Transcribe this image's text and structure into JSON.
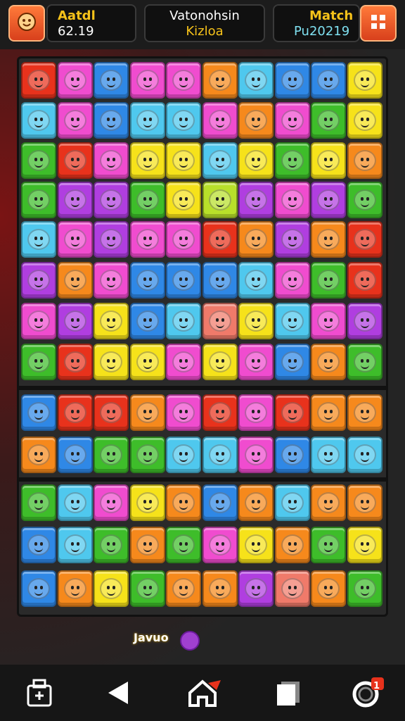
{
  "hud": {
    "left_title": "Aatdl",
    "left_value": "62.19",
    "mid_title": "Vatonohsin",
    "mid_subtitle": "Kizloa",
    "right_title": "Match",
    "right_value": "Pu20219"
  },
  "colors": {
    "red": "#e8321c",
    "pink": "#f04ccf",
    "blue": "#2f88e6",
    "yellow": "#f6e21a",
    "orange": "#f6891c",
    "cyan": "#4fc8ee",
    "green": "#3ebd2a",
    "purple": "#b03ee0",
    "magenta": "#e8468a",
    "lime": "#b8e02a",
    "salmon": "#f07a6a"
  },
  "board": {
    "rows": [
      [
        "red",
        "pink",
        "blue",
        "pink",
        "pink",
        "orange",
        "cyan",
        "blue",
        "blue",
        "yellow"
      ],
      [
        "cyan",
        "pink",
        "blue",
        "cyan",
        "cyan",
        "pink",
        "orange",
        "pink",
        "green",
        "yellow"
      ],
      [
        "green",
        "red",
        "pink",
        "yellow",
        "yellow",
        "cyan",
        "yellow",
        "green",
        "yellow",
        "orange"
      ],
      [
        "green",
        "purple",
        "purple",
        "green",
        "yellow",
        "lime",
        "purple",
        "pink",
        "purple",
        "green"
      ],
      [
        "cyan",
        "pink",
        "purple",
        "pink",
        "pink",
        "red",
        "orange",
        "purple",
        "orange",
        "red"
      ],
      [
        "purple",
        "orange",
        "pink",
        "blue",
        "blue",
        "blue",
        "cyan",
        "pink",
        "green",
        "red"
      ],
      [
        "pink",
        "purple",
        "yellow",
        "blue",
        "cyan",
        "salmon",
        "yellow",
        "cyan",
        "pink",
        "purple"
      ],
      [
        "green",
        "red",
        "yellow",
        "yellow",
        "pink",
        "yellow",
        "pink",
        "blue",
        "orange",
        "green"
      ],
      [
        "blue",
        "red",
        "red",
        "orange",
        "pink",
        "red",
        "pink",
        "red",
        "orange",
        "orange"
      ],
      [
        "orange",
        "blue",
        "green",
        "green",
        "cyan",
        "cyan",
        "pink",
        "blue",
        "cyan",
        "cyan"
      ],
      [
        "green",
        "cyan",
        "pink",
        "yellow",
        "orange",
        "blue",
        "orange",
        "cyan",
        "orange",
        "orange"
      ],
      [
        "blue",
        "cyan",
        "green",
        "orange",
        "green",
        "pink",
        "yellow",
        "orange",
        "green",
        "yellow"
      ],
      [
        "blue",
        "orange",
        "yellow",
        "green",
        "orange",
        "orange",
        "purple",
        "salmon",
        "orange",
        "green"
      ]
    ]
  },
  "bonus": {
    "label": "Javuo"
  },
  "nav": {
    "badge_count": "1"
  }
}
